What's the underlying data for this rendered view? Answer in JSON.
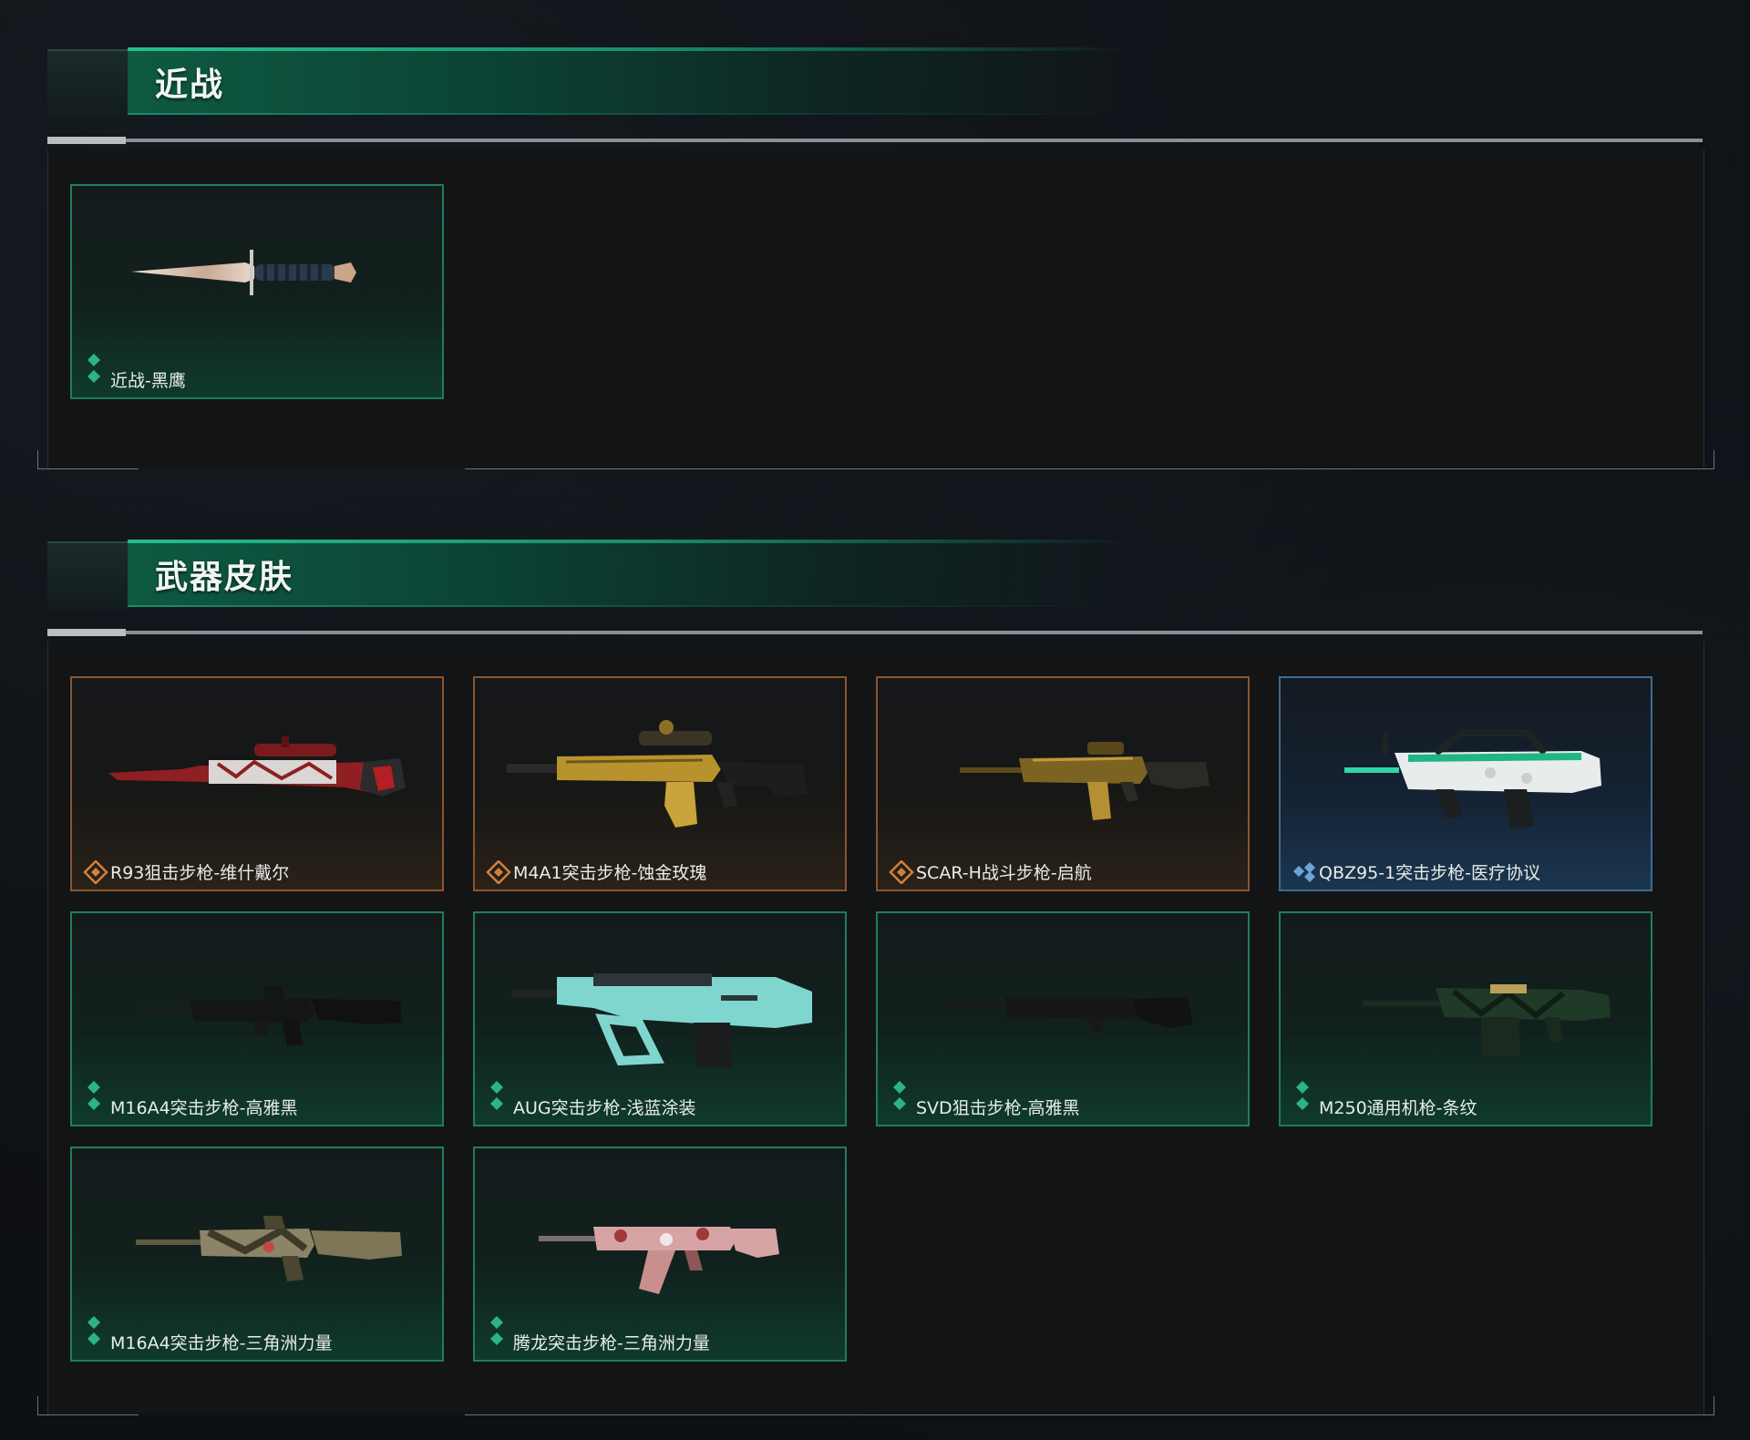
{
  "sections": [
    {
      "title": "近战",
      "items": [
        {
          "name": "近战-黑鹰",
          "rarity": "green",
          "weapon": "knife"
        }
      ]
    },
    {
      "title": "武器皮肤",
      "items": [
        {
          "name": "R93狙击步枪-维什戴尔",
          "rarity": "orange",
          "weapon": "sniper-red"
        },
        {
          "name": "M4A1突击步枪-蚀金玫瑰",
          "rarity": "orange",
          "weapon": "rifle-gold"
        },
        {
          "name": "SCAR-H战斗步枪-启航",
          "rarity": "orange",
          "weapon": "scar-gold"
        },
        {
          "name": "QBZ95-1突击步枪-医疗协议",
          "rarity": "blue",
          "weapon": "bullpup-white"
        },
        {
          "name": "M16A4突击步枪-高雅黑",
          "rarity": "green",
          "weapon": "m16-black"
        },
        {
          "name": "AUG突击步枪-浅蓝涂装",
          "rarity": "green",
          "weapon": "aug-teal"
        },
        {
          "name": "SVD狙击步枪-高雅黑",
          "rarity": "green",
          "weapon": "svd-black"
        },
        {
          "name": "M250通用机枪-条纹",
          "rarity": "green",
          "weapon": "lmg-camo"
        },
        {
          "name": "M16A4突击步枪-三角洲力量",
          "rarity": "green",
          "weapon": "m16-camo"
        },
        {
          "name": "腾龙突击步枪-三角洲力量",
          "rarity": "green",
          "weapon": "ak-pink"
        }
      ]
    }
  ],
  "colors": {
    "green_rarity": "#2bb487",
    "orange_rarity": "#d0803f",
    "blue_rarity": "#6aa5d6",
    "header_green": "#0e5a43"
  }
}
